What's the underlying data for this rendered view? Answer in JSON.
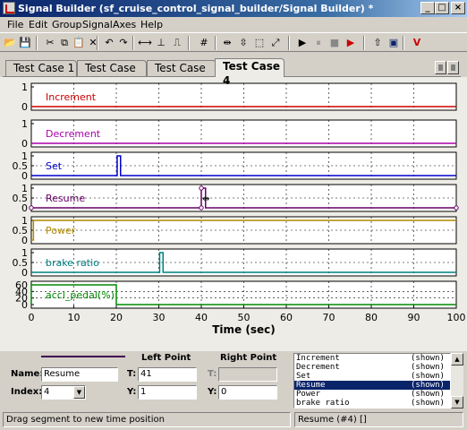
{
  "window": {
    "title": "Signal Builder (sf_cruise_control_signal_builder/Signal Builder) *",
    "min_glyph": "_",
    "max_glyph": "□",
    "close_glyph": "×"
  },
  "menu": [
    "File",
    "Edit",
    "Group",
    "Signal",
    "Axes",
    "Help"
  ],
  "toolbar": {
    "icons": [
      {
        "name": "open-icon",
        "glyph": "📂"
      },
      {
        "name": "save-icon",
        "glyph": "💾"
      },
      {
        "name": "cut-icon",
        "glyph": "✂"
      },
      {
        "name": "copy-icon",
        "glyph": "⧉"
      },
      {
        "name": "paste-icon",
        "glyph": "📋"
      },
      {
        "name": "delete-icon",
        "glyph": "✕"
      },
      {
        "name": "undo-icon",
        "glyph": "↶"
      },
      {
        "name": "redo-icon",
        "glyph": "↷"
      },
      {
        "name": "constant-segment-icon",
        "glyph": "⟷"
      },
      {
        "name": "step-icon",
        "glyph": "⊥"
      },
      {
        "name": "pulse-icon",
        "glyph": "⎍"
      },
      {
        "name": "grid-icon",
        "glyph": "#"
      },
      {
        "name": "snap-horizontal-icon",
        "glyph": "⇹"
      },
      {
        "name": "snap-vertical-icon",
        "glyph": "⇳"
      },
      {
        "name": "zoom-box-icon",
        "glyph": "⬚"
      },
      {
        "name": "zoom-fit-icon",
        "glyph": "⤢"
      },
      {
        "name": "start-icon",
        "glyph": "▶"
      },
      {
        "name": "pause-icon",
        "glyph": "⏸"
      },
      {
        "name": "stop-icon",
        "glyph": "■"
      },
      {
        "name": "run-all-icon",
        "glyph": "▶"
      },
      {
        "name": "move-up-icon",
        "glyph": "⇧"
      },
      {
        "name": "block-icon",
        "glyph": "▣"
      },
      {
        "name": "verify-icon",
        "glyph": "V"
      }
    ]
  },
  "tabs": [
    {
      "label": "Test Case 1",
      "active": false
    },
    {
      "label": "Test Case 2",
      "active": false
    },
    {
      "label": "Test Case 3",
      "active": false
    },
    {
      "label": "Test Case 4",
      "active": true
    }
  ],
  "chart_data": {
    "type": "line",
    "xlabel": "Time (sec)",
    "xlim": [
      0,
      100
    ],
    "x_ticks": [
      0,
      10,
      20,
      30,
      40,
      50,
      60,
      70,
      80,
      90,
      100
    ],
    "grid": true,
    "axes": [
      {
        "name": "Increment",
        "color": "#cc0000",
        "ytick_labels": [
          "1",
          "0"
        ],
        "ylim": [
          0,
          1
        ],
        "x": [
          0,
          100
        ],
        "y": [
          0,
          0
        ]
      },
      {
        "name": "Decrement",
        "color": "#aa00aa",
        "ytick_labels": [
          "1",
          "0"
        ],
        "ylim": [
          0,
          1
        ],
        "x": [
          0,
          100
        ],
        "y": [
          0,
          0
        ]
      },
      {
        "name": "Set",
        "color": "#0000cc",
        "ytick_labels": [
          "1",
          "0.5",
          "0"
        ],
        "ylim": [
          0,
          1
        ],
        "x": [
          0,
          20.2,
          20.2,
          21,
          21,
          100
        ],
        "y": [
          0,
          0,
          1,
          1,
          0,
          0
        ]
      },
      {
        "name": "Resume",
        "color": "#660066",
        "ytick_labels": [
          "1",
          "0.5",
          "0"
        ],
        "ylim": [
          0,
          1
        ],
        "x": [
          0,
          40,
          40,
          41,
          41,
          100
        ],
        "y": [
          0,
          0,
          1,
          1,
          0,
          0
        ],
        "selected": true
      },
      {
        "name": "Power",
        "color": "#b08800",
        "ytick_labels": [
          "1",
          "0.5",
          "0"
        ],
        "ylim": [
          0,
          1
        ],
        "x": [
          0,
          0.5,
          0.5,
          100
        ],
        "y": [
          0,
          0,
          1,
          1
        ]
      },
      {
        "name": "brake ratio",
        "color": "#008080",
        "ytick_labels": [
          "1",
          "0.5",
          "0"
        ],
        "ylim": [
          0,
          1
        ],
        "x": [
          0,
          30.2,
          30.2,
          31,
          31,
          100
        ],
        "y": [
          0,
          0,
          1,
          1,
          0,
          0
        ]
      },
      {
        "name": "accl_pedal(%)",
        "color": "#008800",
        "ytick_labels": [
          "60",
          "40",
          "20",
          "0"
        ],
        "ylim": [
          0,
          60
        ],
        "x": [
          0,
          0,
          20,
          20,
          100
        ],
        "y": [
          0,
          60,
          60,
          0,
          0
        ]
      }
    ]
  },
  "panel": {
    "header_left_point": "Left Point",
    "header_right_point": "Right Point",
    "name_label": "Name:",
    "name_value": "Resume",
    "index_label": "Index:",
    "index_value": "4",
    "left_t_label": "T:",
    "left_t_value": "41",
    "left_y_label": "Y:",
    "left_y_value": "1",
    "right_t_label": "T:",
    "right_t_value": "",
    "right_y_label": "Y:",
    "right_y_value": "0"
  },
  "signal_list": [
    {
      "name": "Increment",
      "status": "(shown)",
      "selected": false
    },
    {
      "name": "Decrement",
      "status": "(shown)",
      "selected": false
    },
    {
      "name": "Set",
      "status": "(shown)",
      "selected": false
    },
    {
      "name": "Resume",
      "status": "(shown)",
      "selected": true
    },
    {
      "name": "Power",
      "status": "(shown)",
      "selected": false
    },
    {
      "name": "brake ratio",
      "status": "(shown)",
      "selected": false
    }
  ],
  "status": {
    "message": "Drag segment to new time position",
    "selection": "Resume (#4)  []"
  },
  "colors": {
    "legend_line": "#400050",
    "selected_segment": "#660066"
  }
}
